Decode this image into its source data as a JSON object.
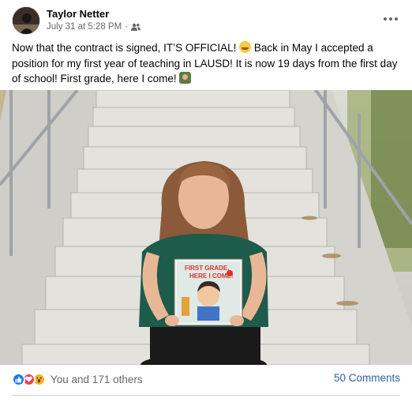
{
  "post": {
    "author": "Taylor Netter",
    "date": "July 31 at 5:28 PM",
    "privacy_icon": "friends-icon",
    "text_part1": "Now that the contract is signed, IT’S OFFICIAL!",
    "text_part2": "Back in May I accepted a position for my first year of teaching in LAUSD! It is now 19 days from the first day of school! First grade, here I come!",
    "emoji_1": "partying-face-emoji",
    "emoji_2": "teacher-emoji",
    "more_icon": "more-options-icon"
  },
  "photo": {
    "book_title_line1": "FIRST GRADE,",
    "book_title_line2": "HERE I COME!"
  },
  "footer": {
    "reaction_icons": [
      "like-icon",
      "love-icon",
      "wow-icon"
    ],
    "reaction_text": "You and 171 others",
    "comments_text": "50 Comments"
  },
  "colors": {
    "link": "#2d5fa8",
    "secondary_text": "#65676b",
    "like": "#1877f2",
    "love": "#f33e58",
    "wow": "#f7b125"
  }
}
